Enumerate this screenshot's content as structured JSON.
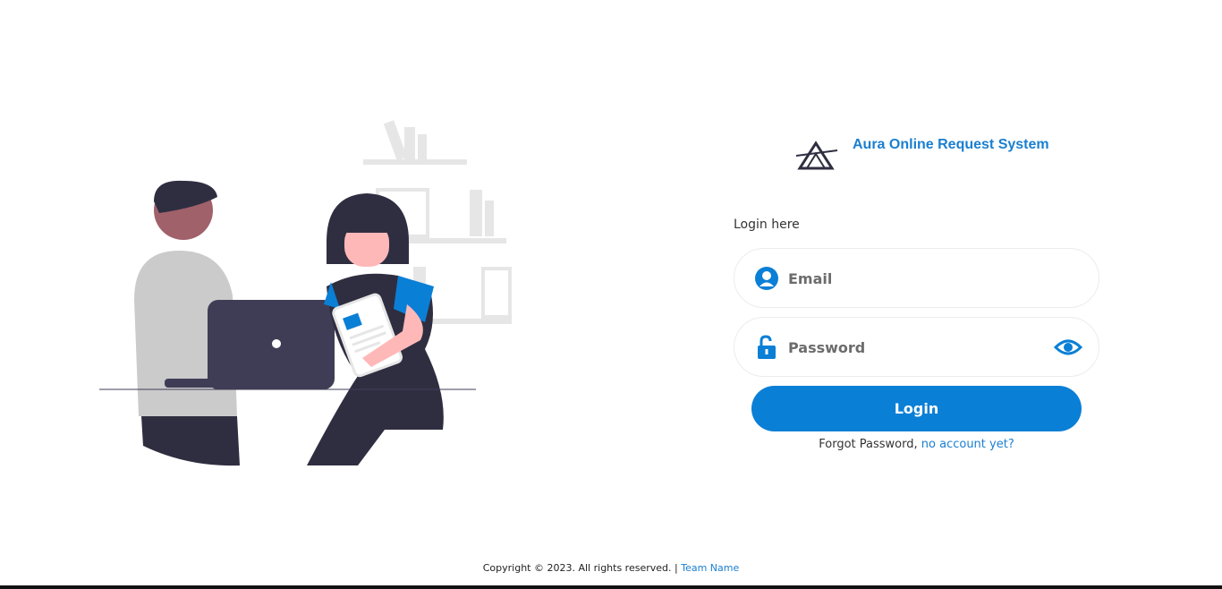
{
  "brand": {
    "name": "Aura Online Request System",
    "logo_icon": "triangle-logo-icon"
  },
  "login": {
    "heading": "Login here",
    "email_placeholder": "Email",
    "password_placeholder": "Password",
    "email_icon": "user-circle-icon",
    "password_icon": "unlock-icon",
    "toggle_icon": "eye-icon",
    "button_label": "Login",
    "forgot_text": "Forgot Password,",
    "signup_link": "no account yet?"
  },
  "footer": {
    "copyright": "Copyright © 2023. All rights reserved. |",
    "team_link": "Team Name"
  },
  "colors": {
    "accent": "#0a7fd6",
    "link": "#1a7fd0",
    "text": "#333333"
  }
}
